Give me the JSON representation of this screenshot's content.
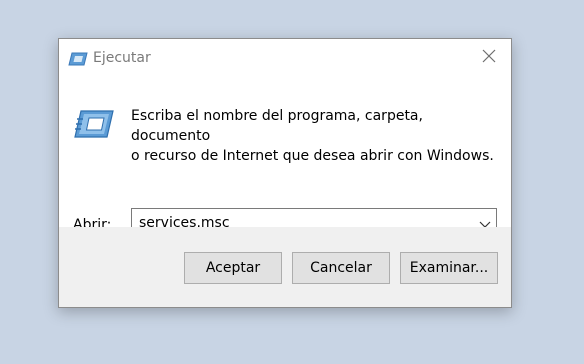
{
  "window": {
    "title": "Ejecutar",
    "title_icon": "run-icon",
    "close_icon": "close-icon"
  },
  "prompt": {
    "line1": "Escriba el nombre del programa, carpeta, documento",
    "line2": "o recurso de Internet que desea abrir con Windows."
  },
  "open_field": {
    "label": "Abrir:",
    "value": "services.msc",
    "dropdown_icon": "chevron-down-icon"
  },
  "buttons": {
    "accept": "Aceptar",
    "cancel": "Cancelar",
    "browse": "Examinar..."
  },
  "colors": {
    "background": "#c8d4e4",
    "footer": "#f0f0f0",
    "button": "#e1e1e1",
    "title_text": "#7a7a7a",
    "icon_blue": "#4a8fd0"
  }
}
